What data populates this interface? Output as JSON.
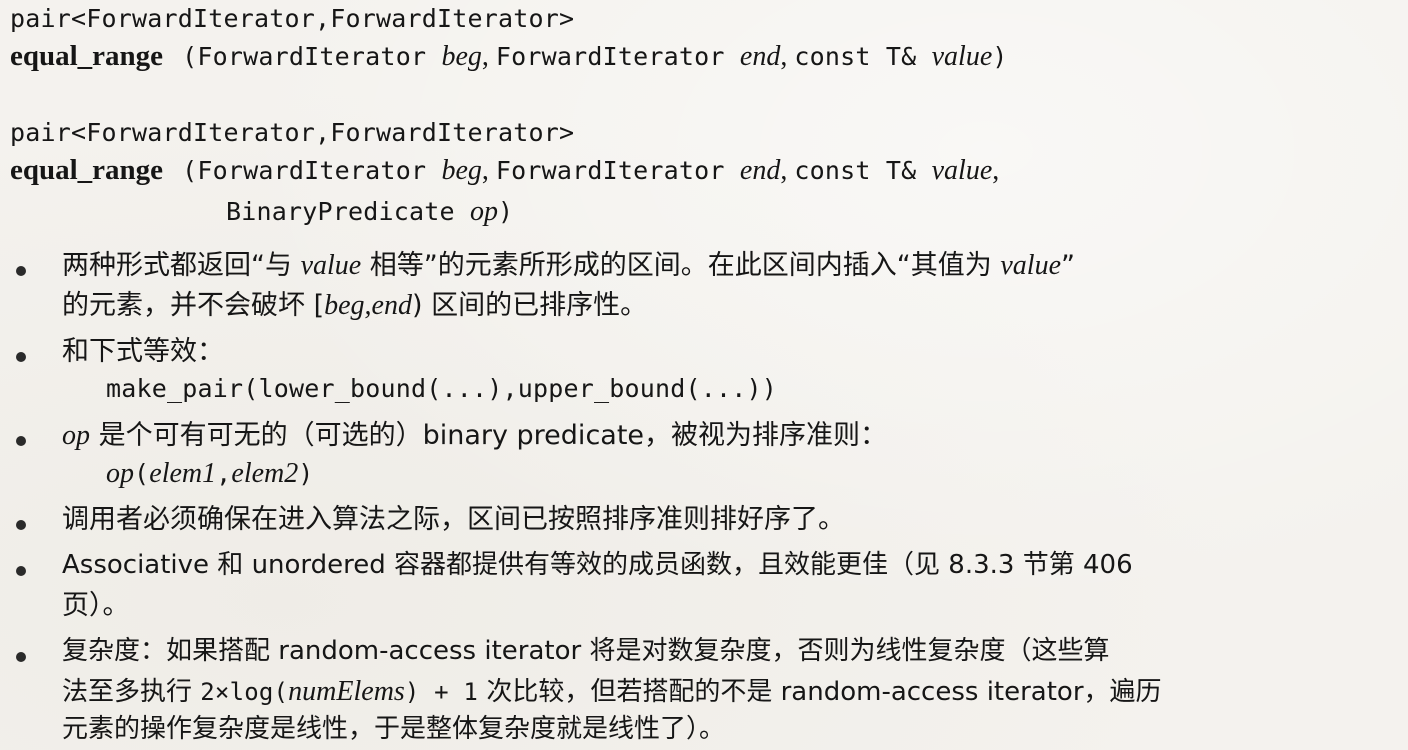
{
  "signature1": {
    "return_type": "pair<ForwardIterator,ForwardIterator>",
    "name": "equal_range",
    "open": "(",
    "p1_type": "ForwardIterator ",
    "p1_name": "beg",
    "sep1": ", ",
    "p2_type": "ForwardIterator ",
    "p2_name": "end",
    "sep2": ", ",
    "p3_type": "const T& ",
    "p3_name": "value",
    "close": ")"
  },
  "signature2": {
    "return_type": "pair<ForwardIterator,ForwardIterator>",
    "name": "equal_range",
    "open": "(",
    "p1_type": "ForwardIterator ",
    "p1_name": "beg",
    "sep1": ", ",
    "p2_type": "ForwardIterator ",
    "p2_name": "end",
    "sep2": ", ",
    "p3_type": "const T& ",
    "p3_name": "value",
    "sep3": ",",
    "p4_type": "BinaryPredicate ",
    "p4_name": "op",
    "close": ")"
  },
  "bullets": {
    "b1": {
      "l1_a": "两种形式都返回“与 ",
      "l1_b": "value",
      "l1_c": " 相等”的元素所形成的区间。在此区间内插入“其值为 ",
      "l1_d": "value",
      "l1_e": "”",
      "l2_a": "的元素，并不会破坏 [",
      "l2_b": "beg,end",
      "l2_c": ") 区间的已排序性。"
    },
    "b2": {
      "l1": "和下式等效：",
      "code": "make_pair(lower_bound(...),upper_bound(...))"
    },
    "b3": {
      "l1_a": "op",
      "l1_b": " 是个可有可无的（可选的）binary predicate，被视为排序准则：",
      "code_a": "op",
      "code_b": "(",
      "code_c": "elem1",
      "code_d": ",",
      "code_e": "elem2",
      "code_f": ")"
    },
    "b4": {
      "l1": "调用者必须确保在进入算法之际，区间已按照排序准则排好序了。"
    },
    "b5": {
      "l1": "Associative 和 unordered 容器都提供有等效的成员函数，且效能更佳（见 8.3.3 节第 406",
      "l2": "页）。"
    },
    "b6": {
      "l1": "复杂度：如果搭配 random-access iterator 将是对数复杂度，否则为线性复杂度（这些算",
      "l2_a": "法至多执行 ",
      "l2_b": "2×log(",
      "l2_c": "numElems",
      "l2_d": ") + 1",
      "l2_e": " 次比较，但若搭配的不是 random-access iterator，遍历",
      "l3": "元素的操作复杂度是线性，于是整体复杂度就是线性了）。"
    }
  }
}
